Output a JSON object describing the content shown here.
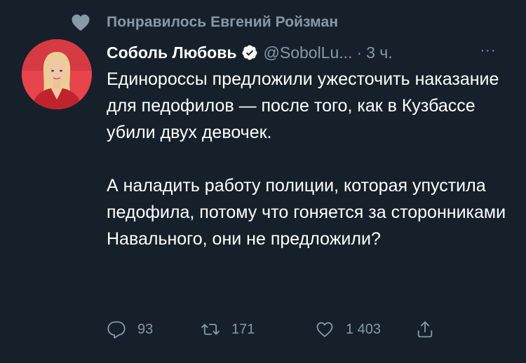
{
  "liked_banner": {
    "text": "Понравилось Евгений Ройзман",
    "icon": "heart-icon"
  },
  "tweet": {
    "author_name": "Соболь Любовь",
    "verified": true,
    "handle": "@SobolLu...",
    "separator": "·",
    "time": "3 ч.",
    "more_label": "···",
    "paragraphs": [
      "Единороссы предложили ужесточить наказание для педофилов — после того, как в Кузбассе убили двух девочек.",
      "А наладить работу полиции, которая упустила педофила, потому что гоняется за сторонниками Навального, они не предложили?"
    ]
  },
  "actions": {
    "replies": "93",
    "retweets": "171",
    "likes": "1 403"
  },
  "colors": {
    "background": "#15202b",
    "muted": "#8899a6",
    "text": "#ffffff",
    "verified": "#ffffff",
    "avatar_bg": "#e8444c"
  }
}
